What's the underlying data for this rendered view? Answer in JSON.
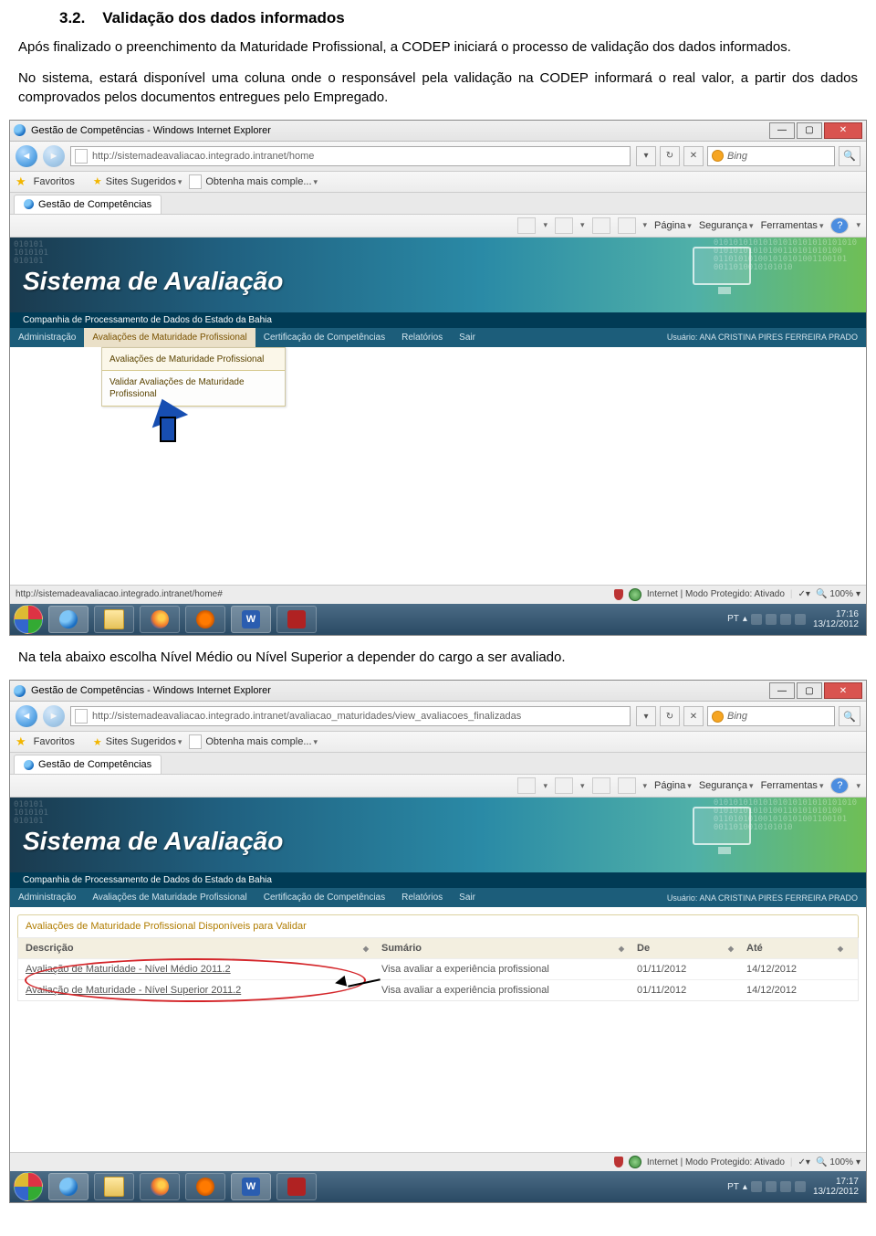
{
  "doc": {
    "section_number": "3.2.",
    "section_title": "Validação dos dados informados",
    "para1": "Após finalizado o preenchimento da Maturidade Profissional, a CODEP iniciará o processo de validação dos dados informados.",
    "para2": "No sistema, estará disponível uma coluna onde o responsável pela validação na CODEP informará o real valor, a partir dos dados comprovados pelos documentos entregues pelo Empregado.",
    "between": "Na tela abaixo escolha Nível Médio ou Nível Superior a depender do cargo a ser avaliado."
  },
  "browser1": {
    "title": "Gestão de Competências - Windows Internet Explorer",
    "url": "http://sistemadeavaliacao.integrado.intranet/home",
    "search_placeholder": "Bing",
    "favorites_label": "Favoritos",
    "sites_sug": "Sites Sugeridos",
    "obtenha": "Obtenha mais comple...",
    "tab_label": "Gestão de Competências",
    "toolbar": {
      "pagina": "Página",
      "seguranca": "Segurança",
      "ferramentas": "Ferramentas"
    },
    "status_url": "http://sistemadeavaliacao.integrado.intranet/home#",
    "status_mode": "Internet | Modo Protegido: Ativado",
    "zoom": "100%",
    "clock_time": "17:16",
    "clock_date": "13/12/2012",
    "lang": "PT"
  },
  "browser2": {
    "title": "Gestão de Competências - Windows Internet Explorer",
    "url": "http://sistemadeavaliacao.integrado.intranet/avaliacao_maturidades/view_avaliacoes_finalizadas",
    "search_placeholder": "Bing",
    "favorites_label": "Favoritos",
    "sites_sug": "Sites Sugeridos",
    "obtenha": "Obtenha mais comple...",
    "tab_label": "Gestão de Competências",
    "toolbar": {
      "pagina": "Página",
      "seguranca": "Segurança",
      "ferramentas": "Ferramentas"
    },
    "status_mode": "Internet | Modo Protegido: Ativado",
    "zoom": "100%",
    "clock_time": "17:17",
    "clock_date": "13/12/2012",
    "lang": "PT"
  },
  "app": {
    "brand": "Sistema de Avaliação",
    "subtitle": "Companhia de Processamento de Dados do Estado da Bahia",
    "menu": {
      "administracao": "Administração",
      "avaliacoes": "Avaliações de Maturidade Profissional",
      "certificacao": "Certificação de Competências",
      "relatorios": "Relatórios",
      "sair": "Sair"
    },
    "user_label": "Usuário:",
    "user_name": "ANA CRISTINA PIRES FERREIRA PRADO",
    "digits_left": "010101\n1010101\n010101",
    "digits_right": "01010101010101010101010101010\n01010101010100110101010100\n011010101001010101001100101\n0011010010101010"
  },
  "dropdown": {
    "item1": "Avaliações de Maturidade Profissional",
    "item2": "Validar Avaliações de Maturidade Profissional"
  },
  "panel": {
    "title": "Avaliações de Maturidade Profissional Disponíveis para Validar",
    "columns": {
      "descricao": "Descrição",
      "sumario": "Sumário",
      "de": "De",
      "ate": "Até"
    },
    "rows": [
      {
        "desc": "Avaliação de Maturidade - Nível Médio 2011.2",
        "sum": "Visa avaliar a experiência profissional",
        "de": "01/11/2012",
        "ate": "14/12/2012"
      },
      {
        "desc": "Avaliação de Maturidade - Nível Superior 2011.2",
        "sum": "Visa avaliar a experiência profissional",
        "de": "01/11/2012",
        "ate": "14/12/2012"
      }
    ]
  }
}
